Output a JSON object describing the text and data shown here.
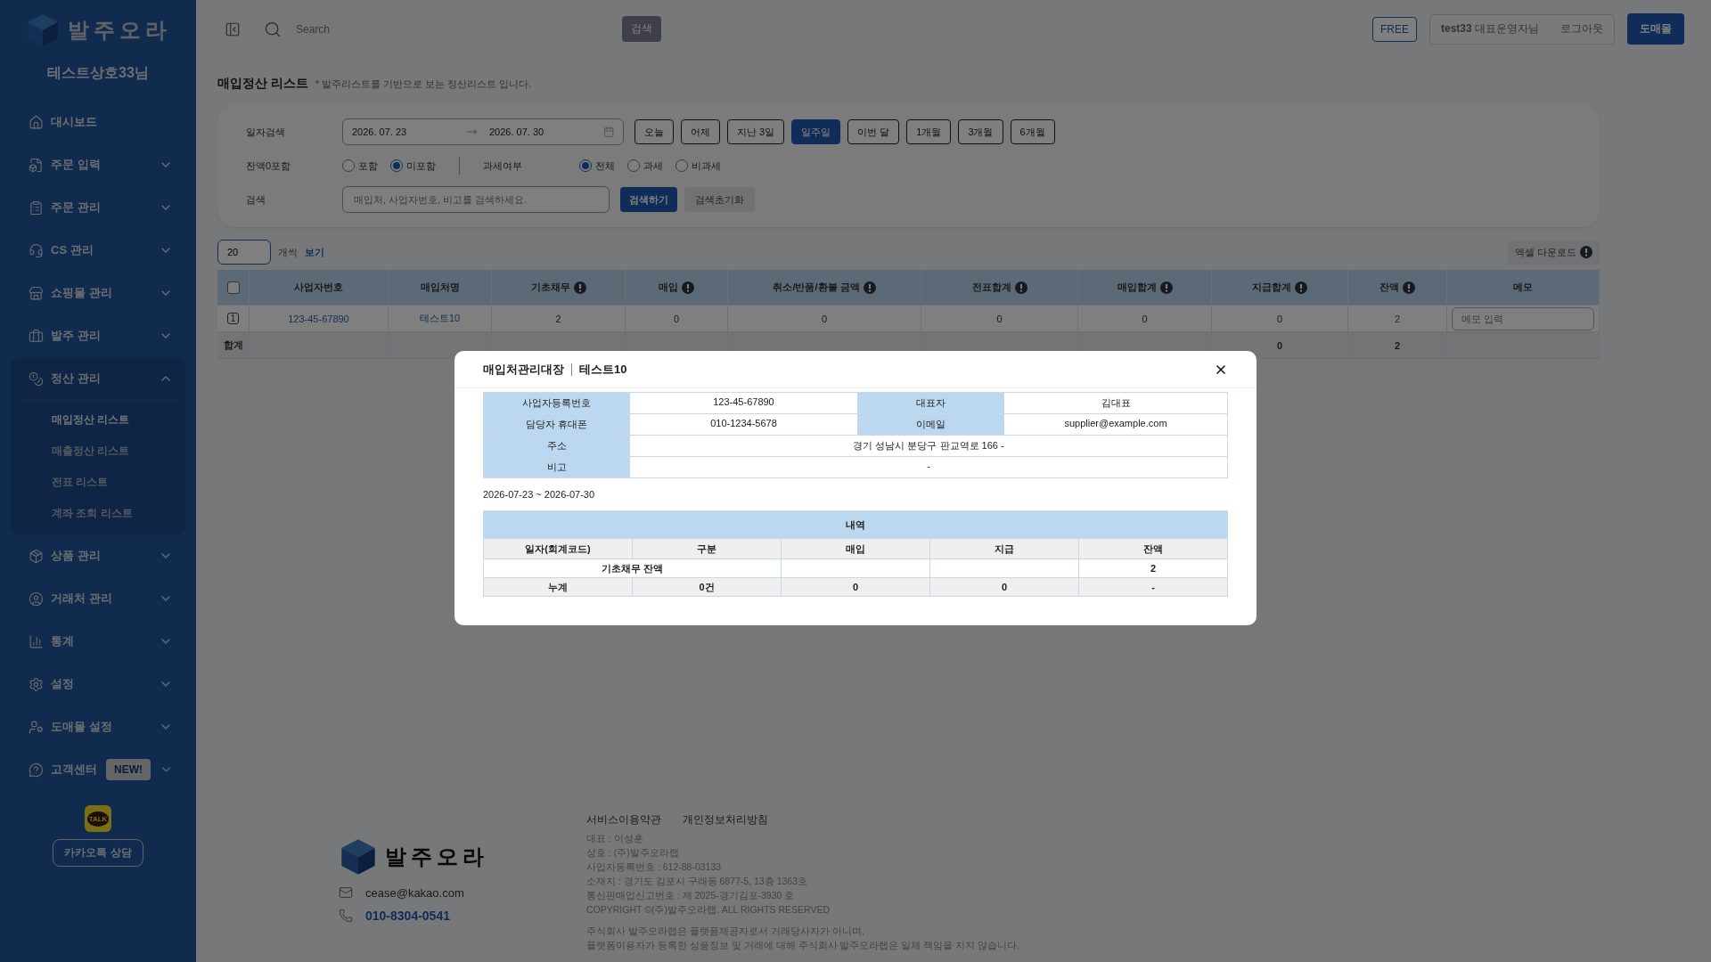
{
  "sidebar": {
    "logo": "발주오라",
    "shop_name": "테스트상호33님",
    "items": [
      {
        "kind": "link",
        "label": "대시보드"
      },
      {
        "kind": "group",
        "label": "주문 입력",
        "expanded": false
      },
      {
        "kind": "group",
        "label": "주문 관리",
        "expanded": false
      },
      {
        "kind": "group",
        "label": "CS 관리",
        "expanded": false
      },
      {
        "kind": "group",
        "label": "쇼핑몰 관리",
        "expanded": false
      },
      {
        "kind": "group",
        "label": "발주 관리",
        "expanded": false
      },
      {
        "kind": "group",
        "label": "정산 관리",
        "expanded": true,
        "children": [
          {
            "label": "매입정산 리스트",
            "selected": true
          },
          {
            "label": "매출정산 리스트",
            "selected": false
          },
          {
            "label": "전표 리스트",
            "selected": false
          },
          {
            "label": "계좌 조회 리스트",
            "selected": false
          }
        ]
      },
      {
        "kind": "group",
        "label": "상품 관리",
        "expanded": false
      },
      {
        "kind": "group",
        "label": "거래처 관리",
        "expanded": false
      },
      {
        "kind": "group",
        "label": "통계",
        "expanded": false
      },
      {
        "kind": "group",
        "label": "설정",
        "expanded": false
      },
      {
        "kind": "group",
        "label": "도매몰 설정",
        "expanded": false
      },
      {
        "kind": "group",
        "label": "고객센터",
        "badge": "NEW!",
        "expanded": false
      }
    ],
    "kakao": {
      "badge": "TALK",
      "label": "카카오톡 상담"
    }
  },
  "topbar": {
    "search": {
      "placeholder": "Search"
    },
    "search_button": "검색",
    "plan": "FREE",
    "user": "**test33** 대표운영자님",
    "logout": "로그아웃",
    "shop_button": "도매몰"
  },
  "page": {
    "title": "매입정산 리스트",
    "note": "* 발주리스트를 기반으로 보는 정산리스트 입니다."
  },
  "filters": {
    "date_label": "일자검색",
    "date_from": "2026. 07. 23",
    "date_to": "2026. 07. 30",
    "presets": [
      {
        "label": "오늘",
        "selected": false
      },
      {
        "label": "어제",
        "selected": false
      },
      {
        "label": "지난 3일",
        "selected": false
      },
      {
        "label": "일주일",
        "selected": true
      },
      {
        "label": "이번 달",
        "selected": false
      },
      {
        "label": "1개월",
        "selected": false
      },
      {
        "label": "3개월",
        "selected": false
      },
      {
        "label": "6개월",
        "selected": false
      }
    ],
    "radio_groups": [
      {
        "label": "잔액0포함",
        "options": [
          {
            "label": "포함",
            "selected": false
          },
          {
            "label": "미포함",
            "selected": true
          }
        ]
      },
      {
        "label": "과세여부",
        "options": [
          {
            "label": "전체",
            "selected": true
          },
          {
            "label": "과세",
            "selected": false
          },
          {
            "label": "비과세",
            "selected": false
          }
        ]
      }
    ],
    "search_label": "검색",
    "search": {
      "placeholder": "매입처, 사업자번호, 비고를 검색하세요."
    },
    "search_button": "검색하기",
    "reset_button": "검색초기화"
  },
  "list": {
    "per_page": "20",
    "per_page_suffix": "개씩",
    "per_page_action": "보기",
    "excel_button": "엑셀 다운로드"
  },
  "table": {
    "select_all_checked": false,
    "columns": [
      {
        "label": "사업자번호",
        "info": false
      },
      {
        "label": "매입처명",
        "info": false
      },
      {
        "label": "기초채무",
        "info": true
      },
      {
        "label": "매입",
        "info": true
      },
      {
        "label": "취소/반품/환불 금액",
        "info": true
      },
      {
        "label": "전표합계",
        "info": true
      },
      {
        "label": "매입합계",
        "info": true
      },
      {
        "label": "지급합계",
        "info": true
      },
      {
        "label": "잔액",
        "info": true
      },
      {
        "label": "메모",
        "info": false
      }
    ],
    "rows": [
      {
        "number": "1",
        "cells": [
          {
            "kind": "link",
            "text": "123-45-67890"
          },
          {
            "kind": "link",
            "text": "테스트10"
          },
          {
            "kind": "text",
            "text": "2"
          },
          {
            "kind": "text",
            "text": "0"
          },
          {
            "kind": "text",
            "text": "0"
          },
          {
            "kind": "text",
            "text": "0"
          },
          {
            "kind": "text",
            "text": "0"
          },
          {
            "kind": "text",
            "text": "0"
          },
          {
            "kind": "link",
            "text": "2"
          },
          {
            "kind": "memo",
            "placeholder": "메모 입력"
          }
        ]
      }
    ],
    "total": {
      "label": "합계",
      "payment_total": "0",
      "balance": "2"
    }
  },
  "modal": {
    "title": "매입처관리대장",
    "vendor": "테스트10",
    "info": [
      [
        {
          "label": "사업자등록번호",
          "value": "123-45-67890"
        },
        {
          "label": "대표자",
          "value": "김대표"
        }
      ],
      [
        {
          "label": "담당자 휴대폰",
          "value": "010-1234-5678"
        },
        {
          "label": "이메일",
          "value": "supplier@example.com"
        }
      ],
      [
        {
          "label": "주소",
          "value": "경기 성남시 분당구 판교역로 166 -"
        }
      ],
      [
        {
          "label": "비고",
          "value": "-"
        }
      ]
    ],
    "period": "2026-07-23 ~ 2026-07-30",
    "ledger": {
      "title": "내역",
      "columns": [
        "일자(회계코드)",
        "구분",
        "매입",
        "지급",
        "잔액"
      ],
      "rows": [
        {
          "kind": "opening",
          "label": "기초채무 잔액",
          "balance": "2"
        },
        {
          "kind": "total",
          "label": "누계",
          "count": "0건",
          "purchase": "0",
          "payment": "0",
          "balance": "-"
        }
      ]
    }
  },
  "footer": {
    "logo": "발주오라",
    "email": "cease@kakao.com",
    "phone": "010-8304-0541",
    "links": [
      "서비스이용약관",
      "개인정보처리방침"
    ],
    "company_lines": [
      "대표 : 이성훈",
      "상호 : (주)발주오라랩",
      "사업자등록번호 : 612-88-03133",
      "소재지 : 경기도 김포시 구래동 6877-5, 13층 1363호",
      "통신판매업신고번호 : 제 2025-경기김포-3930 호",
      "COPYRIGHT ©(주)발주오라랩. ALL RIGHTS RESERVED"
    ],
    "disclaimer": [
      "주식회사 발주오라랩은 플랫폼제공자로서 거래당사자가 아니며,",
      "플랫폼이용자가 등록한 상품정보 및 거래에 대해 주식회사 발주오라랩은 일체 책임을 지지 않습니다."
    ]
  }
}
